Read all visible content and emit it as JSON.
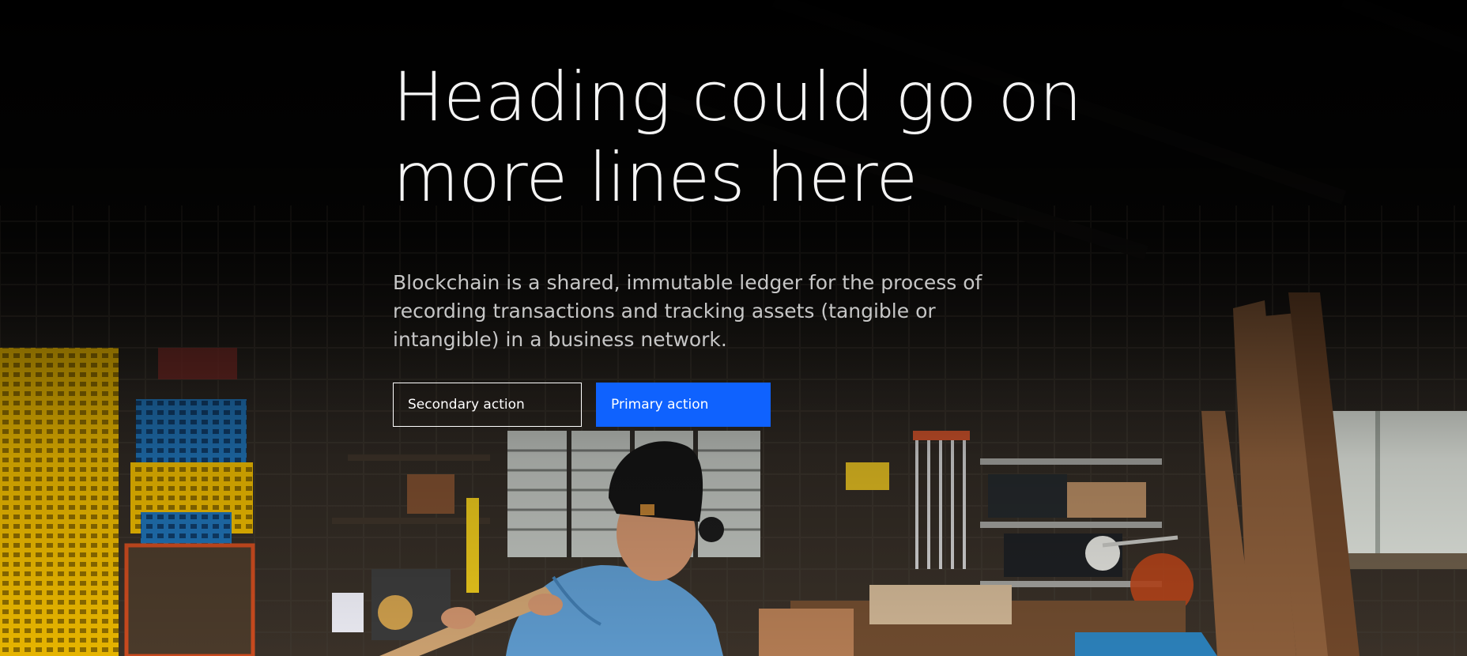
{
  "hero": {
    "heading_lines": [
      "Heading could go on",
      "more lines here"
    ],
    "description_lines": [
      "Blockchain is a shared, immutable ledger for the process of",
      "recording transactions and tracking assets (tangible or",
      "intangible) in a business network."
    ],
    "secondary_action": "Secondary action",
    "primary_action": "Primary action"
  },
  "colors": {
    "primary_button": "#0f62fe",
    "heading_text": "#f4f4f4",
    "description_text": "#c6c6c6",
    "background": "#060606"
  },
  "background_image": "woodworking-workshop-photo"
}
